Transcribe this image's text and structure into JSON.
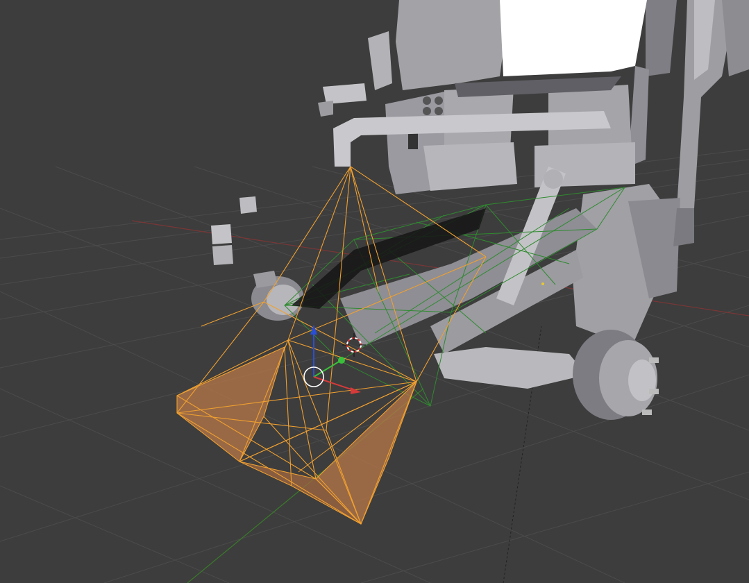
{
  "viewport": {
    "background": "#3d3d3d",
    "grid_color": "#4a4a4a",
    "x_axis_color": "#8a3a3a",
    "y_axis_color": "#3c7a2a",
    "selected_wire_color": "#f0a030",
    "selected_fill_color": "#c07a4a",
    "wire_color": "#2f7a2f",
    "mesh_color": "#a9a9ae",
    "mesh_highlight": "#d4d4d8",
    "mesh_shadow": "#6e6e74"
  },
  "gizmo": {
    "z_color": "#2a4fd6",
    "y_color": "#3bbf3b",
    "x_color": "#d63a3a",
    "pivot_ring": "#ffffff"
  },
  "icons": [
    "3d-cursor-icon",
    "transform-gizmo-icon",
    "pivot-ring-icon"
  ]
}
